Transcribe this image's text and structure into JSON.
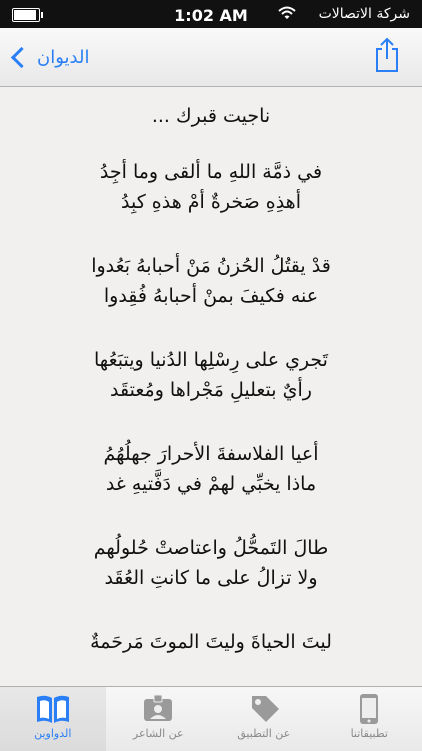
{
  "status_bar": {
    "carrier": "شركة الاتصالات",
    "time": "1:02 AM"
  },
  "nav": {
    "back_label": "الديوان",
    "back_icon": "chevron-left-icon",
    "share_icon": "share-icon"
  },
  "poem": {
    "title": "ناجيت قبرك ...",
    "stanzas": [
      [
        "في ذمَّة اللهِ ما ألقى وما أجِدُ",
        "أهذِهِ صَخرةٌ أمْ هذهِ كبِدُ"
      ],
      [
        "قدْ يقتُلُ الحُزنُ مَنْ أحبابهُ بَعُدوا",
        "عنه فكيفَ بمنْ أحبابهُ فُقِدوا"
      ],
      [
        "تَجري على رِسْلِها الدُنيا ويتبَعُها",
        "رأيٌ بتعليلِ مَجْراها ومُعتقَد"
      ],
      [
        "أعيا الفلاسفةَ الأحرارَ جهلُهُمُ",
        "ماذا يخبِّي لهمْ في دَفَّتيهِ غد"
      ],
      [
        "طالَ التَمحُّلُ واعتاصتْ حُلولُهم",
        "ولا تزالُ على ما كانتِ العُقَد"
      ],
      [
        "ليتَ الحياةَ وليتَ الموتَ مَرحَمةٌ",
        ""
      ]
    ]
  },
  "tabs": [
    {
      "label": "الدواوين",
      "icon": "book-icon",
      "active": true
    },
    {
      "label": "عن الشاعر",
      "icon": "id-card-icon",
      "active": false
    },
    {
      "label": "عن التطبيق",
      "icon": "tag-icon",
      "active": false
    },
    {
      "label": "تطبيقاتنا",
      "icon": "phone-icon",
      "active": false
    }
  ],
  "colors": {
    "accent": "#2a7ff6",
    "background": "#f1f0ee",
    "status_bar": "#111111"
  }
}
